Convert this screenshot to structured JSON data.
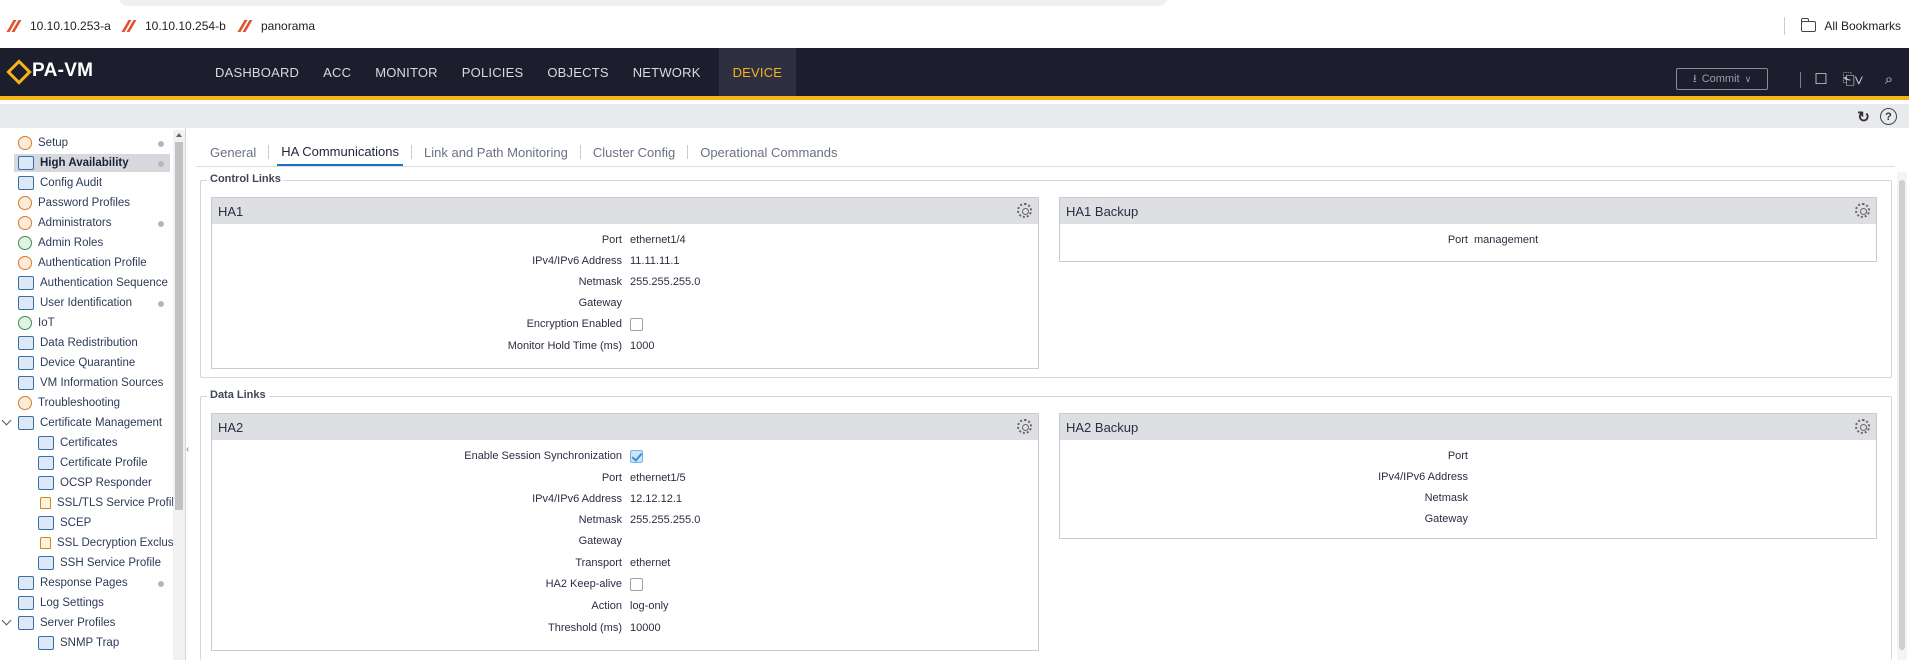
{
  "bookmarks": {
    "items": [
      {
        "label": "10.10.10.253-a",
        "icon": "palo-alto-favicon"
      },
      {
        "label": "10.10.10.254-b",
        "icon": "palo-alto-favicon"
      },
      {
        "label": "panorama",
        "icon": "palo-alto-favicon"
      }
    ],
    "all_label": "All Bookmarks"
  },
  "topnav": {
    "logo": "PA-VM",
    "tabs": [
      "DASHBOARD",
      "ACC",
      "MONITOR",
      "POLICIES",
      "OBJECTS",
      "NETWORK",
      "DEVICE"
    ],
    "active_tab": "DEVICE",
    "commit_label": "Commit",
    "accent": "#f5b41a"
  },
  "sidebar": {
    "items": [
      {
        "label": "Setup",
        "icon": "setup-icon",
        "dot": true
      },
      {
        "label": "High Availability",
        "icon": "ha-icon",
        "dot": true,
        "active": true
      },
      {
        "label": "Config Audit",
        "icon": "config-audit-icon"
      },
      {
        "label": "Password Profiles",
        "icon": "password-profile-icon"
      },
      {
        "label": "Administrators",
        "icon": "user-icon",
        "dot": true
      },
      {
        "label": "Admin Roles",
        "icon": "admin-role-icon"
      },
      {
        "label": "Authentication Profile",
        "icon": "auth-profile-icon"
      },
      {
        "label": "Authentication Sequence",
        "icon": "auth-sequence-icon"
      },
      {
        "label": "User Identification",
        "icon": "user-id-icon",
        "dot": true
      },
      {
        "label": "IoT",
        "icon": "iot-icon"
      },
      {
        "label": "Data Redistribution",
        "icon": "data-redistribution-icon"
      },
      {
        "label": "Device Quarantine",
        "icon": "quarantine-icon"
      },
      {
        "label": "VM Information Sources",
        "icon": "vm-info-icon"
      },
      {
        "label": "Troubleshooting",
        "icon": "troubleshooting-icon"
      },
      {
        "label": "Certificate Management",
        "icon": "certificate-icon",
        "expanded": true
      },
      {
        "label": "Certificates",
        "icon": "certificate-icon",
        "child": true
      },
      {
        "label": "Certificate Profile",
        "icon": "certificate-profile-icon",
        "child": true
      },
      {
        "label": "OCSP Responder",
        "icon": "ocsp-icon",
        "child": true
      },
      {
        "label": "SSL/TLS Service Profile",
        "icon": "lock-icon",
        "child": true
      },
      {
        "label": "SCEP",
        "icon": "scep-icon",
        "child": true
      },
      {
        "label": "SSL Decryption Exclusio",
        "icon": "lock-icon",
        "child": true
      },
      {
        "label": "SSH Service Profile",
        "icon": "ssh-icon",
        "child": true
      },
      {
        "label": "Response Pages",
        "icon": "response-pages-icon",
        "dot": true
      },
      {
        "label": "Log Settings",
        "icon": "log-settings-icon"
      },
      {
        "label": "Server Profiles",
        "icon": "server-profile-icon",
        "expanded": true
      },
      {
        "label": "SNMP Trap",
        "icon": "snmp-icon",
        "child": true
      }
    ]
  },
  "subtabs": {
    "items": [
      "General",
      "HA Communications",
      "Link and Path Monitoring",
      "Cluster Config",
      "Operational Commands"
    ],
    "active": "HA Communications"
  },
  "control_links": {
    "legend": "Control Links",
    "ha1": {
      "title": "HA1",
      "rows": [
        {
          "label": "Port",
          "value": "ethernet1/4"
        },
        {
          "label": "IPv4/IPv6 Address",
          "value": "11.11.11.1"
        },
        {
          "label": "Netmask",
          "value": "255.255.255.0"
        },
        {
          "label": "Gateway",
          "value": ""
        },
        {
          "label": "Encryption Enabled",
          "checkbox": false
        },
        {
          "label": "Monitor Hold Time (ms)",
          "value": "1000"
        }
      ]
    },
    "ha1_backup": {
      "title": "HA1 Backup",
      "rows": [
        {
          "label": "Port",
          "value": "management"
        }
      ]
    }
  },
  "data_links": {
    "legend": "Data Links",
    "ha2": {
      "title": "HA2",
      "rows": [
        {
          "label": "Enable Session Synchronization",
          "checkbox": true
        },
        {
          "label": "Port",
          "value": "ethernet1/5"
        },
        {
          "label": "IPv4/IPv6 Address",
          "value": "12.12.12.1"
        },
        {
          "label": "Netmask",
          "value": "255.255.255.0"
        },
        {
          "label": "Gateway",
          "value": ""
        },
        {
          "label": "Transport",
          "value": "ethernet"
        },
        {
          "label": "HA2 Keep-alive",
          "checkbox": false
        },
        {
          "label": "Action",
          "value": "log-only"
        },
        {
          "label": "Threshold (ms)",
          "value": "10000"
        }
      ]
    },
    "ha2_backup": {
      "title": "HA2 Backup",
      "rows": [
        {
          "label": "Port",
          "value": ""
        },
        {
          "label": "IPv4/IPv6 Address",
          "value": ""
        },
        {
          "label": "Netmask",
          "value": ""
        },
        {
          "label": "Gateway",
          "value": ""
        }
      ]
    }
  }
}
